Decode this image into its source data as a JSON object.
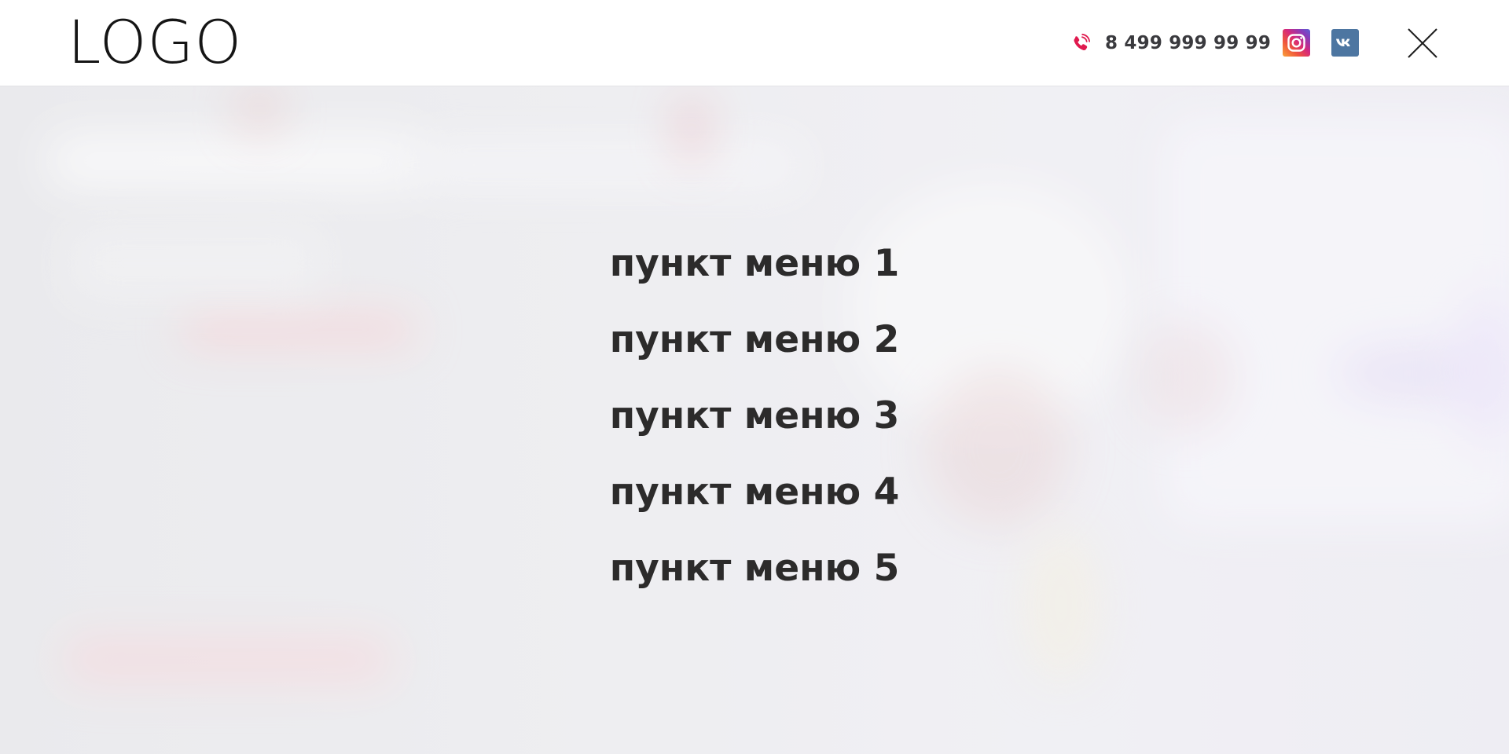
{
  "header": {
    "logo": "LOGO",
    "phone": "8 499 999 99 99",
    "icons": {
      "phone": "phone-icon",
      "instagram": "instagram-icon",
      "vk": "vk-icon",
      "close": "close-icon"
    }
  },
  "menu": {
    "items": [
      {
        "label": "пункт меню 1"
      },
      {
        "label": "пункт меню 2"
      },
      {
        "label": "пункт меню 3"
      },
      {
        "label": "пункт меню 4"
      },
      {
        "label": "пункт меню 5"
      }
    ]
  },
  "colors": {
    "header_bg": "#ffffff",
    "overlay_bg": "#ececef",
    "menu_text": "#2c2b2b",
    "phone_accent": "#e0194e",
    "vk_brand": "#4d76a1"
  }
}
